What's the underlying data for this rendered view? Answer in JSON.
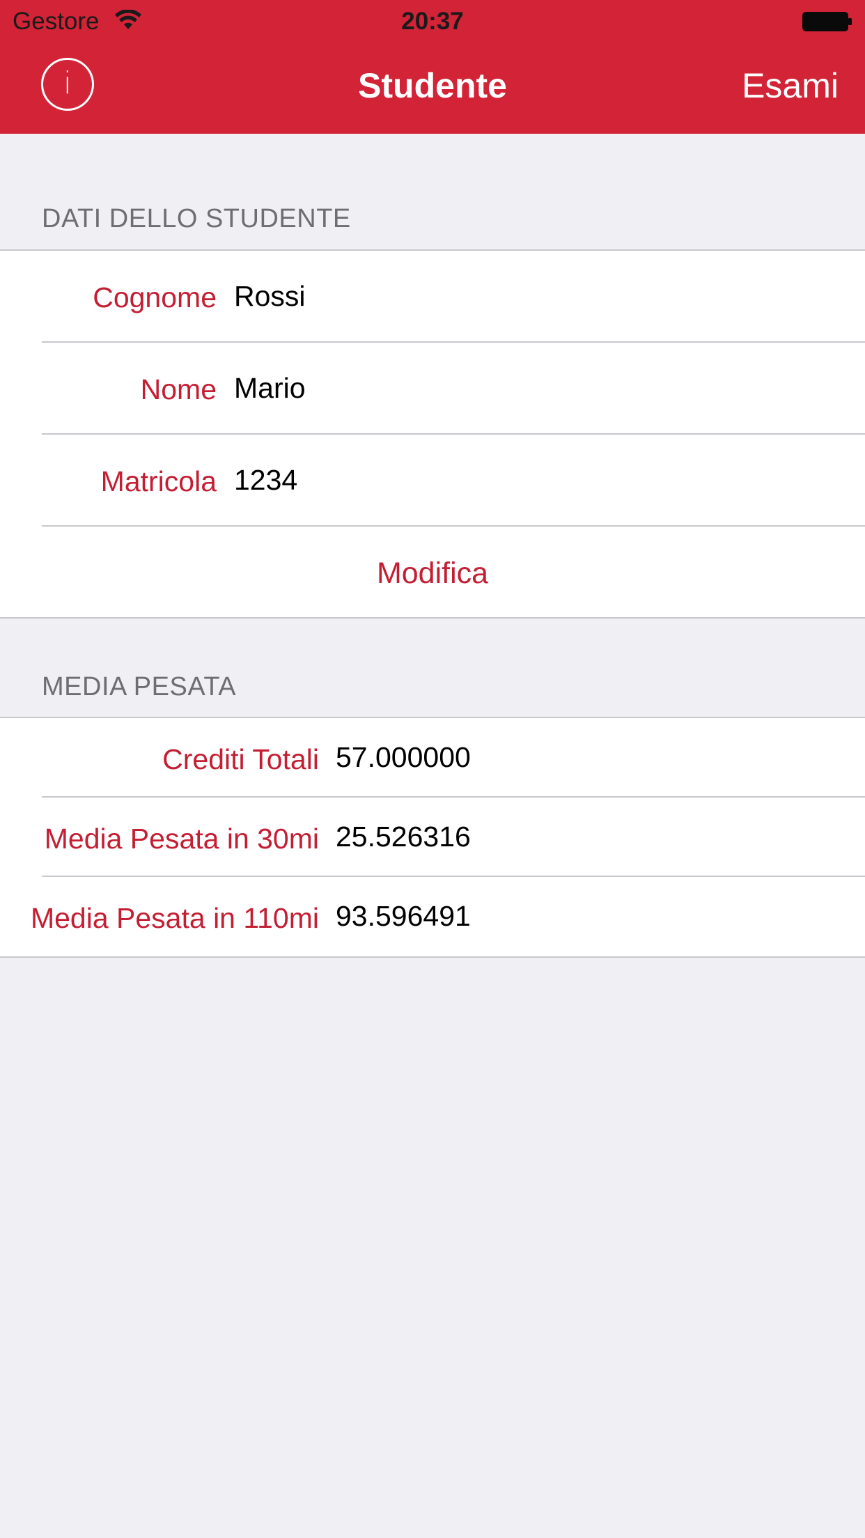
{
  "status_bar": {
    "carrier": "Gestore",
    "time": "20:37",
    "wifi_icon": "wifi-icon",
    "battery_icon": "battery-full-icon"
  },
  "nav": {
    "left_icon": "info-icon",
    "left_glyph": "i",
    "title": "Studente",
    "right_label": "Esami"
  },
  "student_section": {
    "header": "DATI DELLO STUDENTE",
    "rows": [
      {
        "label": "Cognome",
        "value": "Rossi"
      },
      {
        "label": "Nome",
        "value": "Mario"
      },
      {
        "label": "Matricola",
        "value": "1234"
      }
    ],
    "action_label": "Modifica"
  },
  "media_section": {
    "header": "MEDIA PESATA",
    "rows": [
      {
        "label": "Crediti Totali",
        "value": "57.000000"
      },
      {
        "label": "Media Pesata in 30mi",
        "value": "25.526316"
      },
      {
        "label": "Media Pesata in 110mi",
        "value": "93.596491"
      }
    ]
  },
  "colors": {
    "nav_background": "#d22337",
    "accent_text": "#c41e33",
    "page_background": "#efeff4",
    "section_header_text": "#6d6d72"
  }
}
